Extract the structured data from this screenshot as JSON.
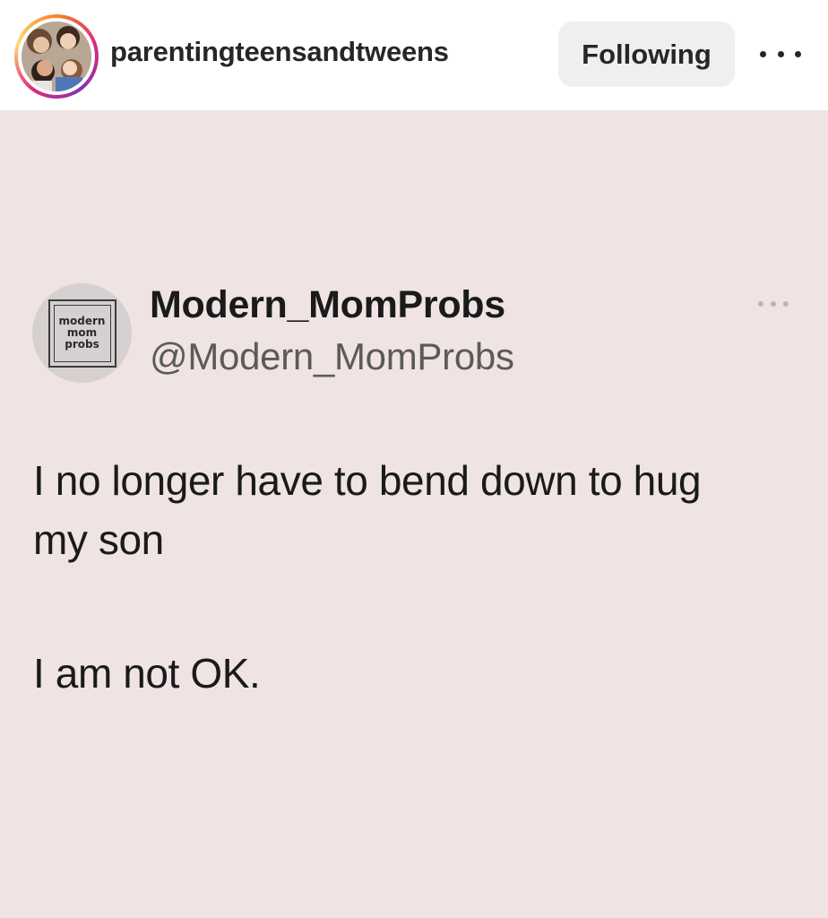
{
  "header": {
    "username": "parentingteensandtweens",
    "follow_label": "Following",
    "more_icon": "more-horizontal-icon"
  },
  "tweet": {
    "avatar_logo_lines": [
      "modern",
      "mom",
      "probs"
    ],
    "display_name": "Modern_MomProbs",
    "handle": "@Modern_MomProbs",
    "text_lines": [
      "I no longer have to bend down to hug",
      "my son",
      "I am not OK."
    ],
    "more_icon": "more-horizontal-icon"
  },
  "colors": {
    "post_background": "#efe3e3",
    "button_background": "#efefef",
    "text_primary": "#262626",
    "handle_gray": "#5a5a5a"
  }
}
